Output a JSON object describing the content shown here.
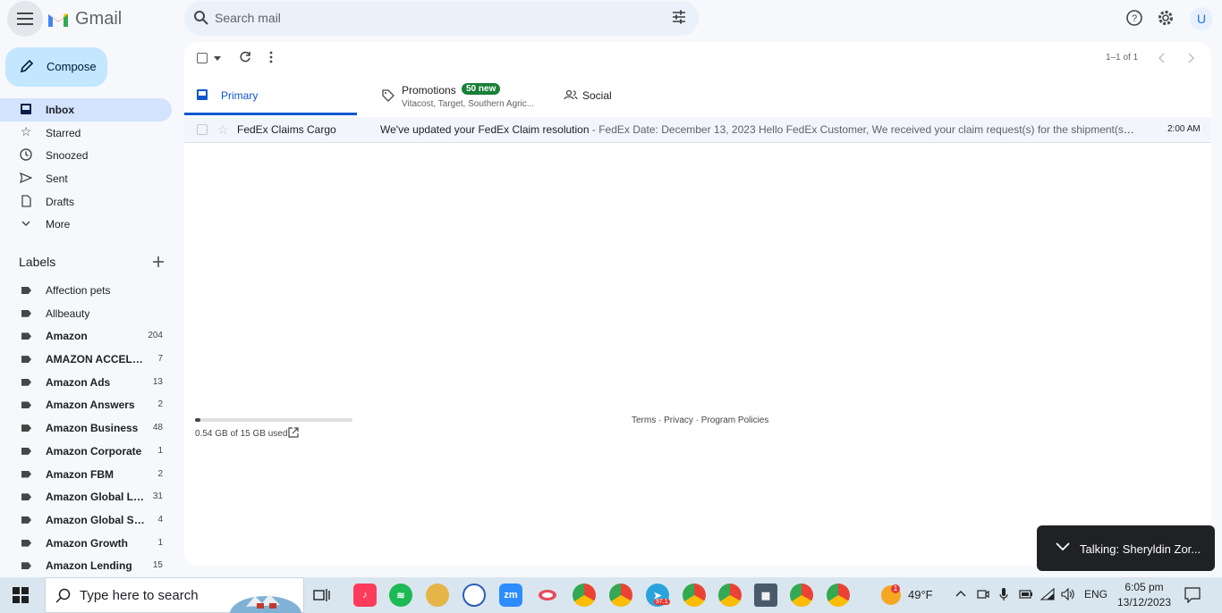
{
  "header": {
    "app_name": "Gmail",
    "search_placeholder": "Search mail",
    "avatar_initial": "U"
  },
  "sidebar": {
    "compose_label": "Compose",
    "items": [
      {
        "label": "Inbox",
        "icon": "inbox-icon",
        "active": true
      },
      {
        "label": "Starred",
        "icon": "star-icon"
      },
      {
        "label": "Snoozed",
        "icon": "clock-icon"
      },
      {
        "label": "Sent",
        "icon": "send-icon"
      },
      {
        "label": "Drafts",
        "icon": "draft-icon"
      },
      {
        "label": "More",
        "icon": "chevron-down-icon"
      }
    ],
    "labels_heading": "Labels",
    "labels": [
      {
        "label": "Affection pets",
        "count": "",
        "bold": false
      },
      {
        "label": "Allbeauty",
        "count": "",
        "bold": false
      },
      {
        "label": "Amazon",
        "count": "204",
        "bold": true
      },
      {
        "label": "AMAZON ACCELER...",
        "count": "7",
        "bold": true
      },
      {
        "label": "Amazon Ads",
        "count": "13",
        "bold": true
      },
      {
        "label": "Amazon Answers",
        "count": "2",
        "bold": true
      },
      {
        "label": "Amazon Business",
        "count": "48",
        "bold": true
      },
      {
        "label": "Amazon Corporate",
        "count": "1",
        "bold": true
      },
      {
        "label": "Amazon FBM",
        "count": "2",
        "bold": true
      },
      {
        "label": "Amazon Global Lo...",
        "count": "31",
        "bold": true
      },
      {
        "label": "Amazon Global Sell...",
        "count": "4",
        "bold": true
      },
      {
        "label": "Amazon Growth",
        "count": "1",
        "bold": true
      },
      {
        "label": "Amazon Lending",
        "count": "15",
        "bold": true
      }
    ]
  },
  "toolbar": {
    "range": "1–1 of 1"
  },
  "tabs": {
    "primary": "Primary",
    "promotions": "Promotions",
    "promotions_badge": "50 new",
    "promotions_sub": "Vitacost, Target, Southern Agric...",
    "social": "Social"
  },
  "emails": [
    {
      "sender": "FedEx Claims Cargo",
      "subject": "We've updated your FedEx Claim resolution",
      "snippet": " - FedEx Date: December 13, 2023 Hello FedEx Customer, We received your claim request(s) for the shipment(s) listed bel...",
      "time": "2:00 AM"
    }
  ],
  "storage": {
    "text": "0.54 GB of 15 GB used",
    "fraction": 0.036
  },
  "footer": {
    "links": "Terms · Privacy · Program Policies"
  },
  "toast": {
    "text": "Talking: Sheryldin Zor..."
  },
  "taskbar": {
    "search_placeholder": "Type here to search",
    "weather": "49°F",
    "language": "ENG",
    "time": "6:05 pm",
    "date": "13/12/2023",
    "telegram_badge": "97.1",
    "weather_badge": "1"
  },
  "colors": {
    "accent": "#0b57d0",
    "compose_bg": "#c2e7ff",
    "active_nav": "#d3e3fd",
    "badge_green": "#188038"
  }
}
